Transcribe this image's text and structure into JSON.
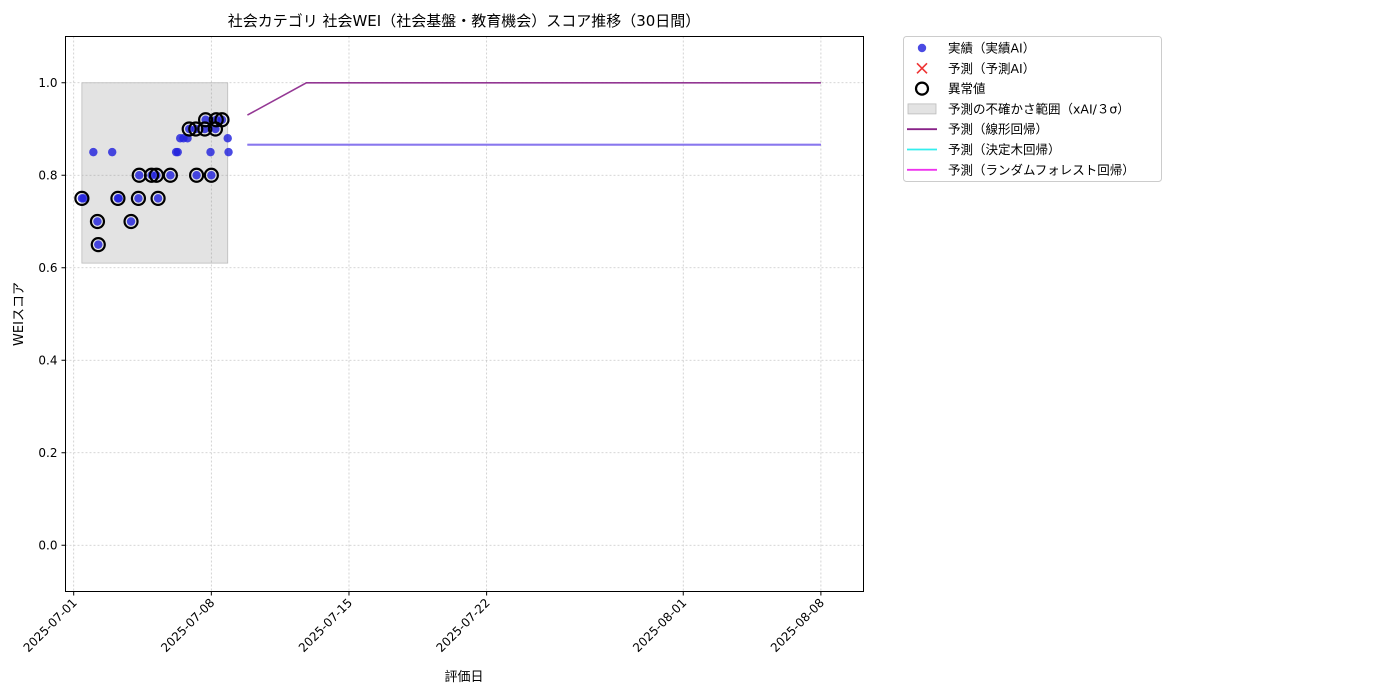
{
  "chart_data": {
    "type": "scatter",
    "title": "社会カテゴリ 社会WEI（社会基盤・教育機会）スコア推移（30日間）",
    "xlabel": "評価日",
    "ylabel": "WEIスコア",
    "xlim": [
      "2025-06-30T14:00",
      "2025-08-10T04:00"
    ],
    "ylim": [
      -0.1,
      1.1
    ],
    "x_ticks": [
      "2025-07-01",
      "2025-07-08",
      "2025-07-15",
      "2025-07-22",
      "2025-08-01",
      "2025-08-08"
    ],
    "y_ticks": [
      0.0,
      0.2,
      0.4,
      0.6,
      0.8,
      1.0
    ],
    "y_tick_labels": [
      "0.0",
      "0.2",
      "0.4",
      "0.6",
      "0.8",
      "1.0"
    ],
    "grid": true,
    "legend_position": "outside-top-right",
    "uncertainty_band": {
      "x_start": "2025-07-01T10:00",
      "x_end": "2025-07-08T20:00",
      "y_low": 0.61,
      "y_high": 1.0
    },
    "series": [
      {
        "name": "実績（実績AI）",
        "kind": "scatter",
        "color": "#2222dd",
        "points": [
          {
            "x": "2025-07-01T10:00",
            "y": 0.75
          },
          {
            "x": "2025-07-01T12:00",
            "y": 0.75
          },
          {
            "x": "2025-07-02T00:00",
            "y": 0.85
          },
          {
            "x": "2025-07-02T05:00",
            "y": 0.7
          },
          {
            "x": "2025-07-02T06:00",
            "y": 0.65
          },
          {
            "x": "2025-07-02T23:00",
            "y": 0.85
          },
          {
            "x": "2025-07-03T06:00",
            "y": 0.75
          },
          {
            "x": "2025-07-03T07:00",
            "y": 0.75
          },
          {
            "x": "2025-07-03T22:00",
            "y": 0.7
          },
          {
            "x": "2025-07-04T07:00",
            "y": 0.75
          },
          {
            "x": "2025-07-04T08:00",
            "y": 0.8
          },
          {
            "x": "2025-07-04T23:00",
            "y": 0.8
          },
          {
            "x": "2025-07-05T05:00",
            "y": 0.8
          },
          {
            "x": "2025-07-05T07:00",
            "y": 0.75
          },
          {
            "x": "2025-07-05T22:00",
            "y": 0.8
          },
          {
            "x": "2025-07-06T05:00",
            "y": 0.85
          },
          {
            "x": "2025-07-06T07:00",
            "y": 0.85
          },
          {
            "x": "2025-07-06T10:00",
            "y": 0.88
          },
          {
            "x": "2025-07-06T14:00",
            "y": 0.88
          },
          {
            "x": "2025-07-06T19:00",
            "y": 0.88
          },
          {
            "x": "2025-07-06T21:00",
            "y": 0.9
          },
          {
            "x": "2025-07-07T05:00",
            "y": 0.9
          },
          {
            "x": "2025-07-07T06:00",
            "y": 0.8
          },
          {
            "x": "2025-07-07T16:00",
            "y": 0.9
          },
          {
            "x": "2025-07-07T17:00",
            "y": 0.92
          },
          {
            "x": "2025-07-07T23:00",
            "y": 0.85
          },
          {
            "x": "2025-07-08T00:00",
            "y": 0.8
          },
          {
            "x": "2025-07-08T05:00",
            "y": 0.9
          },
          {
            "x": "2025-07-08T06:00",
            "y": 0.92
          },
          {
            "x": "2025-07-08T13:00",
            "y": 0.92
          },
          {
            "x": "2025-07-08T20:00",
            "y": 0.88
          },
          {
            "x": "2025-07-08T21:00",
            "y": 0.85
          }
        ]
      },
      {
        "name": "予測（予測AI）",
        "kind": "marker-x",
        "color": "#ee3333",
        "points": []
      },
      {
        "name": "異常値",
        "kind": "outlier-ring",
        "color": "#000000",
        "points": [
          {
            "x": "2025-07-01T10:00",
            "y": 0.75
          },
          {
            "x": "2025-07-02T05:00",
            "y": 0.7
          },
          {
            "x": "2025-07-02T06:00",
            "y": 0.65
          },
          {
            "x": "2025-07-03T06:00",
            "y": 0.75
          },
          {
            "x": "2025-07-03T22:00",
            "y": 0.7
          },
          {
            "x": "2025-07-04T07:00",
            "y": 0.75
          },
          {
            "x": "2025-07-04T08:00",
            "y": 0.8
          },
          {
            "x": "2025-07-04T23:00",
            "y": 0.8
          },
          {
            "x": "2025-07-05T05:00",
            "y": 0.8
          },
          {
            "x": "2025-07-05T07:00",
            "y": 0.75
          },
          {
            "x": "2025-07-05T22:00",
            "y": 0.8
          },
          {
            "x": "2025-07-06T21:00",
            "y": 0.9
          },
          {
            "x": "2025-07-07T05:00",
            "y": 0.9
          },
          {
            "x": "2025-07-07T06:00",
            "y": 0.8
          },
          {
            "x": "2025-07-07T16:00",
            "y": 0.9
          },
          {
            "x": "2025-07-07T17:00",
            "y": 0.92
          },
          {
            "x": "2025-07-08T00:00",
            "y": 0.8
          },
          {
            "x": "2025-07-08T05:00",
            "y": 0.9
          },
          {
            "x": "2025-07-08T06:00",
            "y": 0.92
          },
          {
            "x": "2025-07-08T13:00",
            "y": 0.92
          }
        ]
      },
      {
        "name": "予測（線形回帰）",
        "kind": "line",
        "color": "#882288",
        "points": [
          {
            "x": "2025-07-09T20:00",
            "y": 0.93
          },
          {
            "x": "2025-07-12T20:00",
            "y": 1.0
          },
          {
            "x": "2025-08-08T00:00",
            "y": 1.0
          }
        ]
      },
      {
        "name": "予測（決定木回帰）",
        "kind": "line",
        "color": "#33eeee",
        "points": [
          {
            "x": "2025-07-09T20:00",
            "y": 0.866
          },
          {
            "x": "2025-08-08T00:00",
            "y": 0.866
          }
        ]
      },
      {
        "name": "予測（ランダムフォレスト回帰）",
        "kind": "line",
        "color": "#ee33ee",
        "points": [
          {
            "x": "2025-07-09T20:00",
            "y": 0.866
          },
          {
            "x": "2025-08-08T00:00",
            "y": 0.866
          }
        ]
      }
    ],
    "overlap_line_color": "#8877ee",
    "legend": [
      {
        "label": "実績（実績AI）",
        "kind": "scatter",
        "color": "#2222dd"
      },
      {
        "label": "予測（予測AI）",
        "kind": "marker-x",
        "color": "#ee3333"
      },
      {
        "label": "異常値",
        "kind": "outlier-ring",
        "color": "#000000"
      },
      {
        "label": "予測の不確かさ範囲（xAI/３σ）",
        "kind": "band",
        "color": "#e0e0e0"
      },
      {
        "label": "予測（線形回帰）",
        "kind": "line",
        "color": "#882288"
      },
      {
        "label": "予測（決定木回帰）",
        "kind": "line",
        "color": "#33eeee"
      },
      {
        "label": "予測（ランダムフォレスト回帰）",
        "kind": "line",
        "color": "#ee33ee"
      }
    ]
  }
}
